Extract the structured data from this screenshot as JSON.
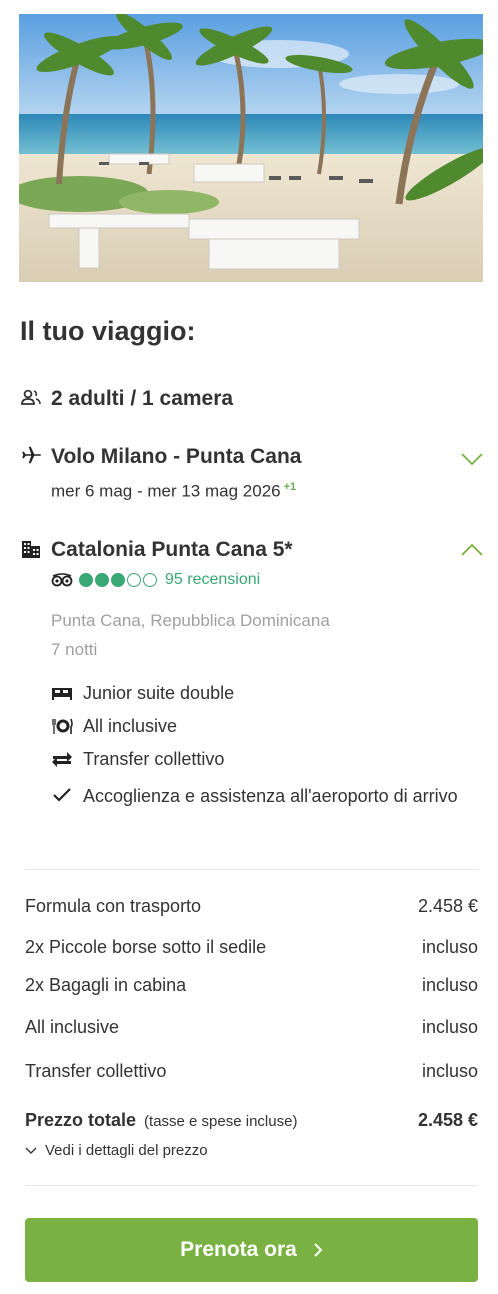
{
  "hero": {
    "image": "beach-resort-photo"
  },
  "trip": {
    "title": "Il tuo viaggio:"
  },
  "guests": {
    "icon": "people-icon",
    "label": "2 adulti / 1 camera"
  },
  "flight": {
    "icon": "airplane-icon",
    "label": "Volo Milano - Punta Cana",
    "dates": "mer 6 mag - mer 13 mag 2026",
    "day_offset": "+1",
    "toggle_icon": "chevron-down-icon"
  },
  "hotel": {
    "icon": "building-icon",
    "name": "Catalonia Punta Cana 5*",
    "toggle_icon": "chevron-up-icon",
    "rating": {
      "score": 3,
      "max": 5,
      "source_icon": "tripadvisor-icon",
      "reviews": "95 recensioni"
    },
    "location": "Punta Cana, Repubblica Dominicana",
    "nights": "7 notti",
    "features": [
      {
        "icon": "bed-icon",
        "label": "Junior suite double"
      },
      {
        "icon": "dining-icon",
        "label": "All inclusive"
      },
      {
        "icon": "transfer-icon",
        "label": "Transfer collettivo"
      },
      {
        "icon": "check-icon",
        "label": "Accoglienza e assistenza all'aeroporto di arrivo"
      }
    ]
  },
  "pricing": {
    "lines": [
      {
        "label": "Formula con trasporto",
        "value": "2.458 €"
      },
      {
        "label": "2x Piccole borse sotto il sedile",
        "value": "incluso"
      },
      {
        "label": "2x Bagagli in cabina",
        "value": "incluso"
      },
      {
        "label": "All inclusive",
        "value": "incluso"
      },
      {
        "label": "Transfer collettivo",
        "value": "incluso"
      }
    ],
    "total_label": "Prezzo totale",
    "total_note": "(tasse e spese incluse)",
    "total_value": "2.458 €",
    "details_link": "Vedi i dettagli del prezzo"
  },
  "cta": {
    "label": "Prenota ora"
  },
  "colors": {
    "accent_green": "#79b242",
    "rating_green": "#3aa876",
    "muted": "#a0a0a0"
  }
}
